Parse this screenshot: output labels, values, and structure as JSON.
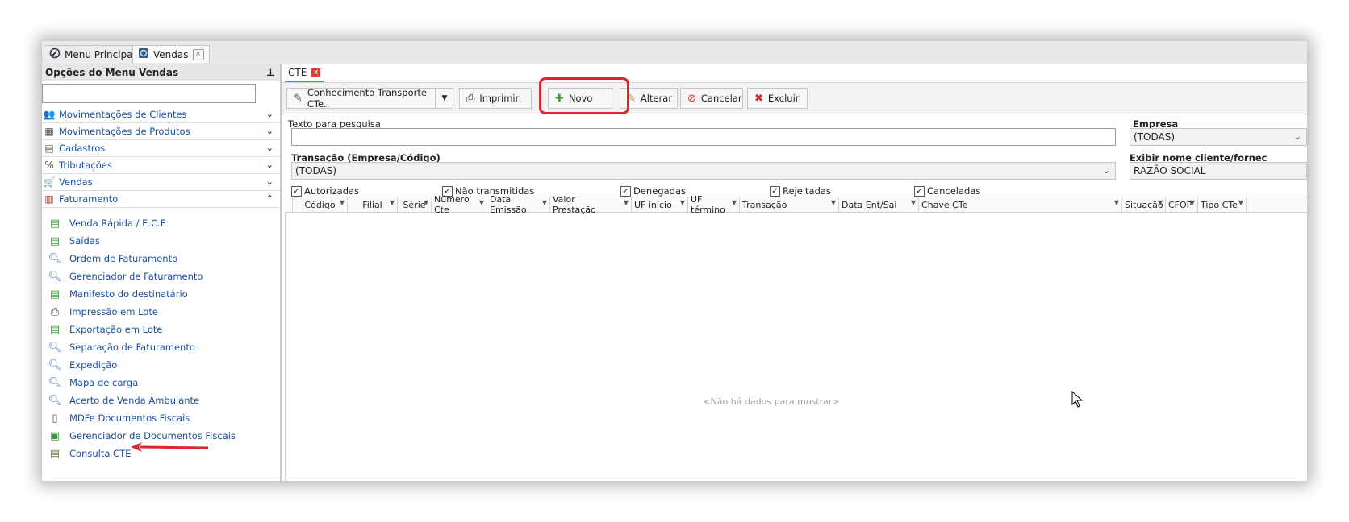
{
  "topbar": {
    "tabs": [
      {
        "label": "Menu Principal",
        "icon": "wrench-icon"
      },
      {
        "label": "Vendas",
        "icon": "vendas-icon",
        "close": "×"
      }
    ]
  },
  "sidebar": {
    "title": "Opções do Menu Vendas",
    "pin": "⊥",
    "groups": [
      {
        "label": "Movimentações de Clientes",
        "chev": "⌄"
      },
      {
        "label": "Movimentações de Produtos",
        "chev": "⌄"
      },
      {
        "label": "Cadastros",
        "chev": "⌄"
      },
      {
        "label": "Tributações",
        "chev": "⌄"
      },
      {
        "label": "Vendas",
        "chev": "⌄"
      },
      {
        "label": "Faturamento",
        "chev": "⌃"
      }
    ],
    "items": [
      {
        "label": "Venda Rápida / E.C.F"
      },
      {
        "label": "Saídas"
      },
      {
        "label": "Ordem de Faturamento"
      },
      {
        "label": "Gerenciador de Faturamento"
      },
      {
        "label": "Manifesto do destinatário"
      },
      {
        "label": "Impressão em Lote"
      },
      {
        "label": "Exportação em Lote"
      },
      {
        "label": "Separação de Faturamento"
      },
      {
        "label": "Expedição"
      },
      {
        "label": "Mapa de carga"
      },
      {
        "label": "Acerto de Venda Ambulante"
      },
      {
        "label": "MDFe Documentos Fiscais"
      },
      {
        "label": "Gerenciador de Documentos Fiscais"
      },
      {
        "label": "Consulta CTE"
      }
    ]
  },
  "main": {
    "tab_label": "CTE",
    "tab_close": "x",
    "toolbar": {
      "conhecimento": "Conhecimento Transporte CTe..",
      "imprimir": "Imprimir",
      "novo": "Novo",
      "alterar": "Alterar",
      "cancelar": "Cancelar",
      "excluir": "Excluir"
    },
    "search_label": "Texto para pesquisa",
    "search_value": "",
    "empresa_label": "Empresa",
    "empresa_value": "(TODAS)",
    "transacao_label": "Transação (Empresa/Código)",
    "transacao_value": "(TODAS)",
    "exibir_label": "Exibir nome cliente/fornec",
    "exibir_value": "RAZÃO SOCIAL",
    "checkboxes": [
      {
        "label": "Autorizadas",
        "checked": true
      },
      {
        "label": "Não transmitidas",
        "checked": true
      },
      {
        "label": "Denegadas",
        "checked": true
      },
      {
        "label": "Rejeitadas",
        "checked": true
      },
      {
        "label": "Canceladas",
        "checked": true
      }
    ],
    "columns": [
      "Código",
      "Filial",
      "Série",
      "Número Cte",
      "Data Emissão",
      "Valor Prestação",
      "UF início",
      "UF término",
      "Transação",
      "Data Ent/Sai",
      "Chave CTe",
      "Situação",
      "CFOP",
      "Tipo CTe"
    ],
    "empty_text": "<Não há dados para mostrar>"
  },
  "colors": {
    "highlight": "#d7282e",
    "link": "#1a4fa0"
  }
}
